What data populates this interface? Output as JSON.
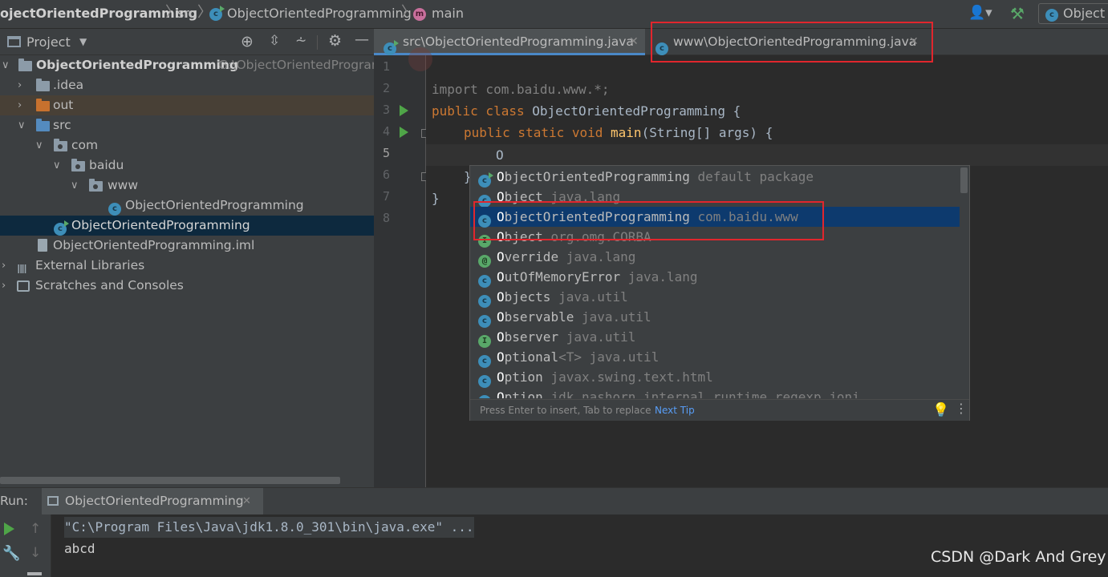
{
  "breadcrumb": {
    "project": "ojectOrientedProgramming",
    "folder": "src",
    "class": "ObjectOrientedProgramming",
    "method": "main"
  },
  "topright": {
    "run_config_label": "Object"
  },
  "project_panel": {
    "title": "Project",
    "tree": [
      {
        "label": "ObjectOrientedProgramming",
        "path": "G:\\ObjectOrientedProgram",
        "type": "module"
      },
      {
        "label": ".idea",
        "type": "folder"
      },
      {
        "label": "out",
        "type": "folder-orange"
      },
      {
        "label": "src",
        "type": "folder-blue"
      },
      {
        "label": "com",
        "type": "package"
      },
      {
        "label": "baidu",
        "type": "package"
      },
      {
        "label": "www",
        "type": "package"
      },
      {
        "label": "ObjectOrientedProgramming",
        "type": "class"
      },
      {
        "label": "ObjectOrientedProgramming",
        "type": "class-run"
      },
      {
        "label": "ObjectOrientedProgramming.iml",
        "type": "file"
      },
      {
        "label": "External Libraries",
        "type": "libraries"
      },
      {
        "label": "Scratches and Consoles",
        "type": "scratches"
      }
    ]
  },
  "tabs": [
    {
      "label": "src\\ObjectOrientedProgramming.java",
      "active": true
    },
    {
      "label": "www\\ObjectOrientedProgramming.java",
      "active": false
    }
  ],
  "editor": {
    "line_numbers": [
      "1",
      "2",
      "3",
      "4",
      "5",
      "6",
      "7",
      "8"
    ],
    "lines": {
      "l2_import": "import",
      "l2_rest": " com.baidu.www.*;",
      "l3_kw": "public class",
      "l3_rest": " ObjectOrientedProgramming {",
      "l4_kw": "public static void",
      "l4_fn": "main",
      "l4_rest": "(String[] args) {",
      "l5_text": "O",
      "l6_text": "}",
      "l7_text": "}"
    }
  },
  "completion": {
    "items": [
      {
        "name_first": "O",
        "name_rest": "bjectOrientedProgramming",
        "type_params": "",
        "package": "default package",
        "icon": "class-run"
      },
      {
        "name_first": "O",
        "name_rest": "bject",
        "type_params": "",
        "package": "java.lang",
        "icon": "class"
      },
      {
        "name_first": "O",
        "name_rest": "bjectOrientedProgramming",
        "type_params": "",
        "package": "com.baidu.www",
        "icon": "class"
      },
      {
        "name_first": "O",
        "name_rest": "bject",
        "type_params": "",
        "package": "org.omg.CORBA",
        "icon": "interface"
      },
      {
        "name_first": "O",
        "name_rest": "verride",
        "type_params": "",
        "package": "java.lang",
        "icon": "annotation"
      },
      {
        "name_first": "O",
        "name_rest": "utOfMemoryError",
        "type_params": "",
        "package": "java.lang",
        "icon": "class"
      },
      {
        "name_first": "O",
        "name_rest": "bjects",
        "type_params": "",
        "package": "java.util",
        "icon": "class-final"
      },
      {
        "name_first": "O",
        "name_rest": "bservable",
        "type_params": "",
        "package": "java.util",
        "icon": "class"
      },
      {
        "name_first": "O",
        "name_rest": "bserver",
        "type_params": "",
        "package": "java.util",
        "icon": "interface"
      },
      {
        "name_first": "O",
        "name_rest": "ptional",
        "type_params": "<T>",
        "package": "java.util",
        "icon": "class-final"
      },
      {
        "name_first": "O",
        "name_rest": "ption",
        "type_params": "",
        "package": "javax.swing.text.html",
        "icon": "class"
      },
      {
        "name_first": "O",
        "name_rest": "ption",
        "type_params": "",
        "package": "jdk.nashorn.internal.runtime.regexp.joni",
        "icon": "class"
      }
    ],
    "selected_index": 2,
    "footer_hint": "Press Enter to insert, Tab to replace",
    "footer_link": "Next Tip"
  },
  "run_panel": {
    "label": "Run:",
    "tab": "ObjectOrientedProgramming",
    "output": [
      "\"C:\\Program Files\\Java\\jdk1.8.0_301\\bin\\java.exe\" ...",
      "abcd"
    ]
  },
  "watermark": "CSDN @Dark And Grey",
  "colors": {
    "highlight_box": "#e1262d",
    "selection": "#0d3a6e",
    "keyword": "#cc7832",
    "method": "#ffc66d"
  }
}
